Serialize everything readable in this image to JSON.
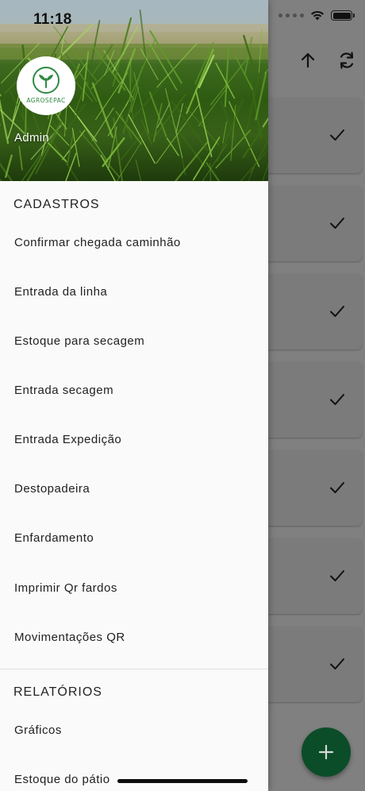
{
  "status_bar": {
    "time": "11:18"
  },
  "header": {
    "user_name": "Admin",
    "logo_text": "AGROSEPAC"
  },
  "sections": [
    {
      "title": "CADASTROS",
      "items": [
        "Confirmar chegada caminhão",
        "Entrada da linha",
        "Estoque para secagem",
        "Entrada secagem",
        "Entrada Expedição",
        "Destopadeira",
        "Enfardamento",
        "Imprimir Qr fardos",
        "Movimentações QR"
      ]
    },
    {
      "title": "RELATÓRIOS",
      "items": [
        "Gráficos",
        "Estoque do pátio"
      ]
    }
  ],
  "background": {
    "checks_count": 7
  },
  "colors": {
    "fab": "#0b4d28",
    "logo_green": "#2f8a44",
    "drawer_bg": "#fafafa"
  },
  "icons": [
    "arrow-up-icon",
    "refresh-icon",
    "check-icon",
    "plus-icon",
    "wifi-icon",
    "battery-icon"
  ]
}
